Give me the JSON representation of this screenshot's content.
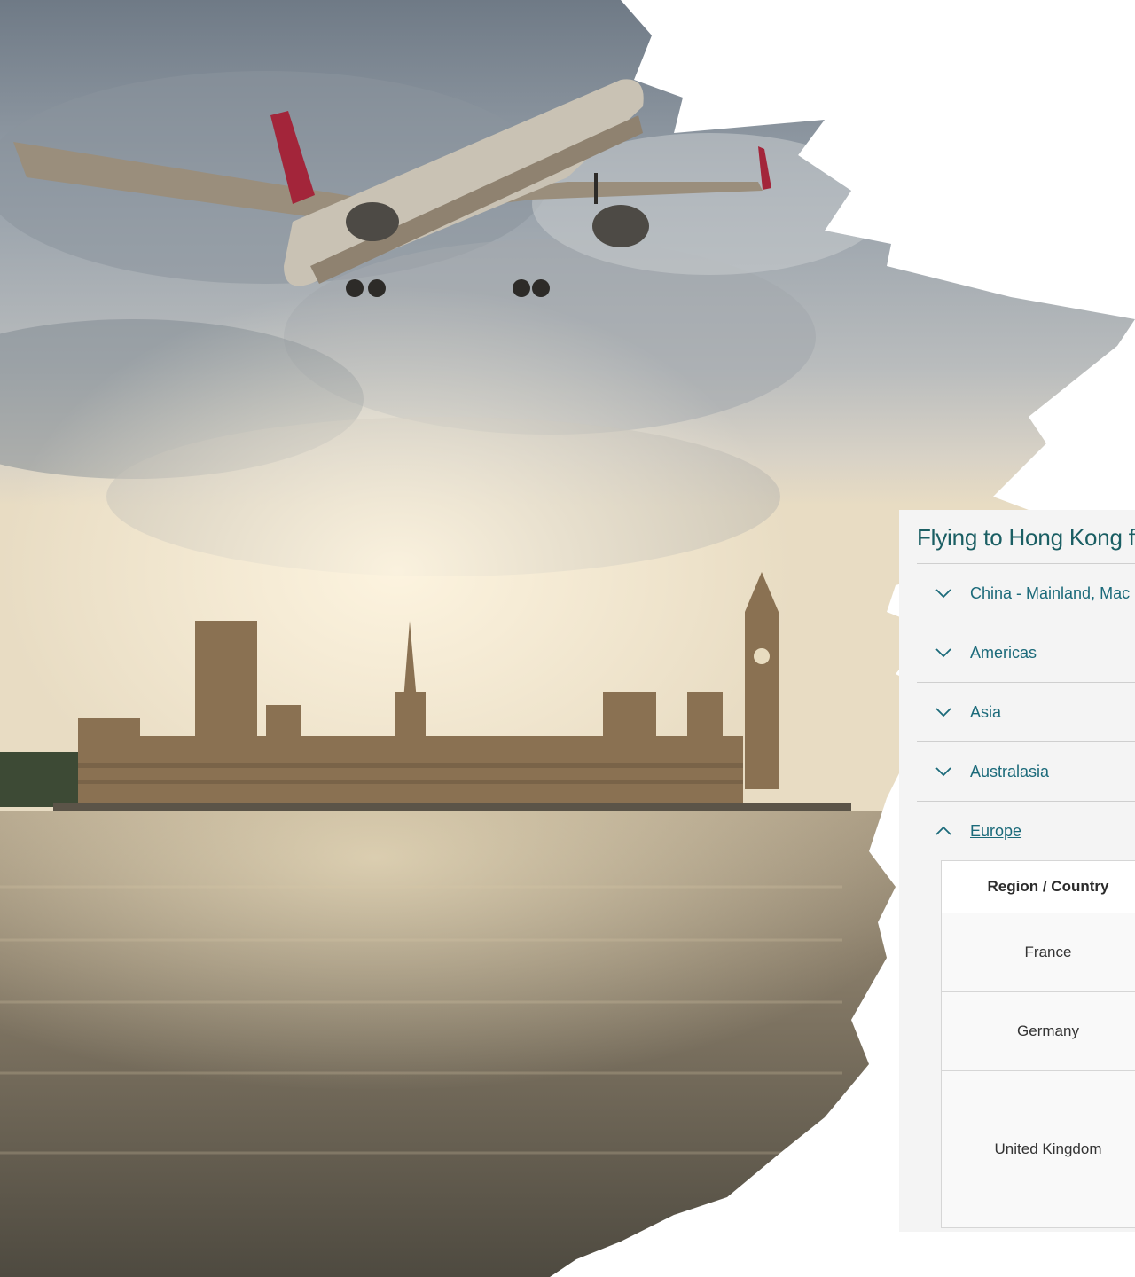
{
  "panel": {
    "title": "Flying to Hong Kong f",
    "accordion": [
      {
        "label": "China - Mainland, Mac",
        "expanded": false
      },
      {
        "label": "Americas",
        "expanded": false
      },
      {
        "label": "Asia",
        "expanded": false
      },
      {
        "label": "Australasia",
        "expanded": false
      },
      {
        "label": "Europe",
        "expanded": true
      }
    ],
    "table": {
      "header": "Region / Country",
      "rows": [
        "France",
        "Germany",
        "United Kingdom"
      ]
    }
  },
  "colors": {
    "title": "#1a5e63",
    "link": "#1b6a7a",
    "panel_bg": "#f4f4f4"
  },
  "icons": {
    "collapsed": "chevron-down-icon",
    "expanded": "chevron-up-icon"
  }
}
